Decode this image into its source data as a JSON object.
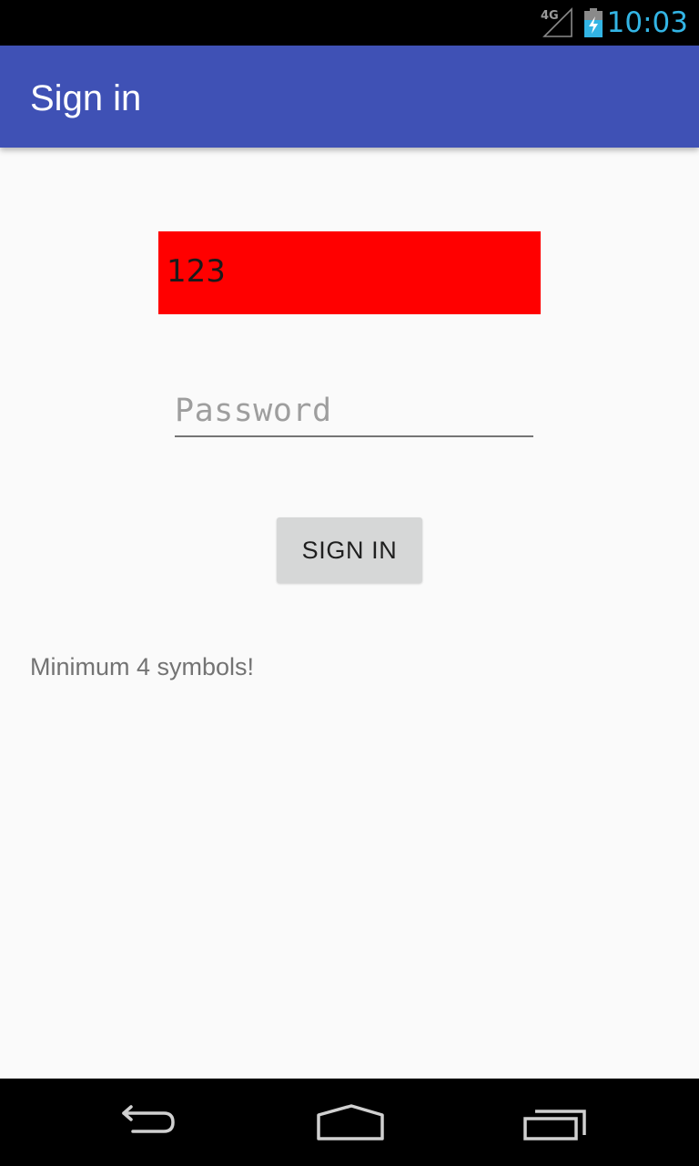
{
  "status_bar": {
    "network_label": "4G",
    "time": "10:03",
    "time_color": "#33b5e5",
    "icons": [
      "signal-4g-icon",
      "battery-charging-icon"
    ]
  },
  "app_bar": {
    "title": "Sign in",
    "color": "#3f51b5"
  },
  "form": {
    "username_value": "123",
    "username_background": "#ff0000",
    "password_placeholder": "Password",
    "password_value": "",
    "signin_label": "SIGN IN",
    "hint": "Minimum 4 symbols!"
  },
  "nav_bar": {
    "icons": [
      "back-icon",
      "home-icon",
      "recent-apps-icon"
    ]
  }
}
